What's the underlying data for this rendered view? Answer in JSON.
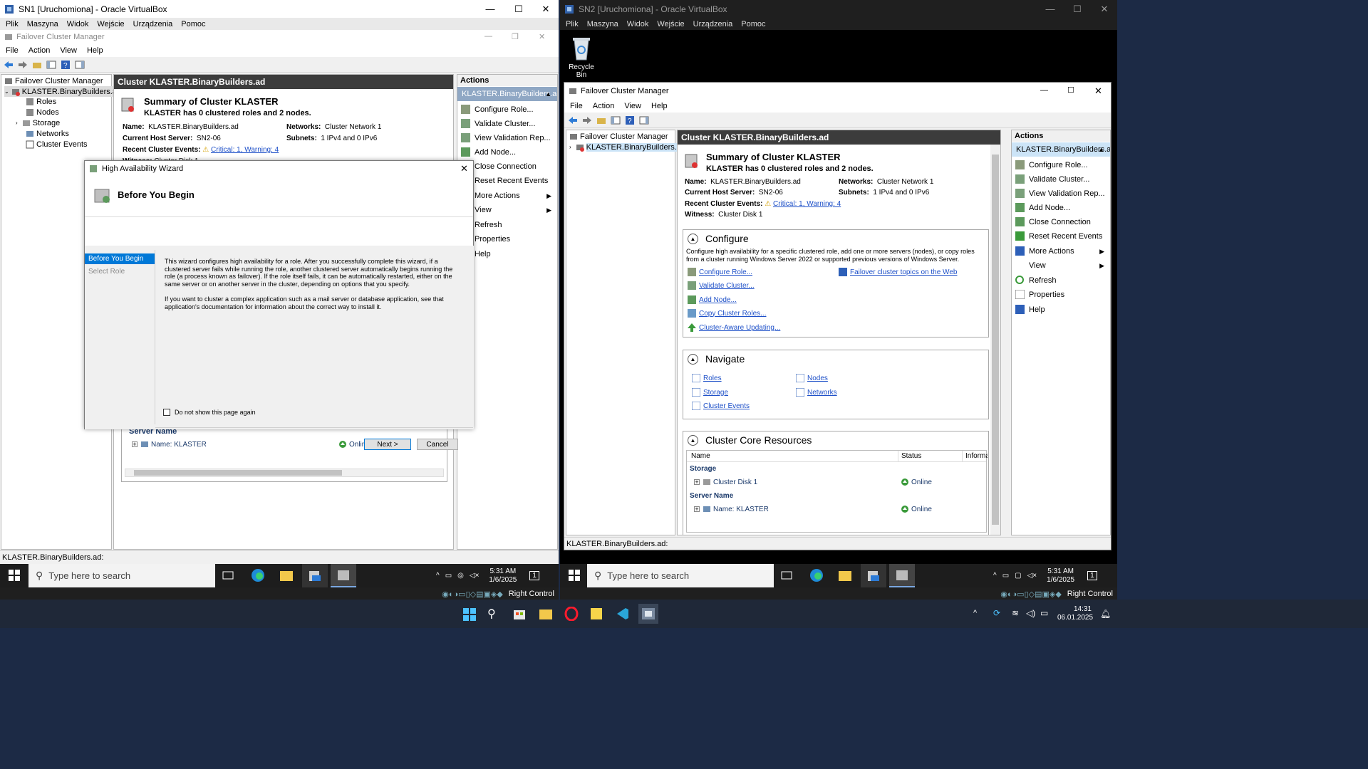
{
  "vm1": {
    "window_title": "SN1 [Uruchomiona] - Oracle VirtualBox",
    "menu": [
      "Plik",
      "Maszyna",
      "Widok",
      "Wejście",
      "Urządzenia",
      "Pomoc"
    ],
    "fcm": {
      "title": "Failover Cluster Manager",
      "menu": [
        "File",
        "Action",
        "View",
        "Help"
      ],
      "tree": {
        "root": "Failover Cluster Manager",
        "cluster": "KLASTER.BinaryBuilders.ad",
        "children": [
          "Roles",
          "Nodes",
          "Storage",
          "Networks",
          "Cluster Events"
        ]
      },
      "center": {
        "header": "Cluster KLASTER.BinaryBuilders.ad",
        "summary_title": "Summary of Cluster KLASTER",
        "summary_sub": "KLASTER has 0 clustered roles and 2 nodes.",
        "name_label": "Name:",
        "name_value": "KLASTER.BinaryBuilders.ad",
        "host_label": "Current Host Server:",
        "host_value": "SN2-06",
        "events_label": "Recent Cluster Events:",
        "events_value": "Critical: 1, Warning: 4",
        "witness_label": "Witness:",
        "witness_value": "Cluster Disk 1",
        "networks_label": "Networks:",
        "networks_value": "Cluster Network 1",
        "subnets_label": "Subnets:",
        "subnets_value": "1 IPv4 and 0 IPv6",
        "server_name_header": "Server Name",
        "server_row_name": "Name: KLASTER",
        "server_row_status": "Online"
      },
      "actions": {
        "header": "Actions",
        "selected": "KLASTER.BinaryBuilders.ad",
        "items": [
          "Configure Role...",
          "Validate Cluster...",
          "View Validation Rep...",
          "Add Node...",
          "Close Connection",
          "Reset Recent Events",
          "More Actions",
          "View",
          "Refresh",
          "Properties",
          "Help"
        ]
      },
      "status": "KLASTER.BinaryBuilders.ad:"
    },
    "wizard": {
      "title": "High Availability Wizard",
      "heading": "Before You Begin",
      "steps": [
        "Before You Begin",
        "Select Role"
      ],
      "para1": "This wizard configures high availability for a role. After you successfully complete this wizard, if a clustered server fails while running the role, another clustered server automatically begins running the role (a process known as failover). If the role itself fails, it can be automatically restarted, either on the same server or on another server in the cluster, depending on options that you specify.",
      "para2": "If you want to cluster a complex application such as a mail server or database application, see that application's documentation for information about the correct way to install it.",
      "checkbox": "Do not show this page again",
      "next": "Next >",
      "cancel": "Cancel"
    },
    "taskbar": {
      "search_placeholder": "Type here to search",
      "time": "5:31 AM",
      "date": "1/6/2025",
      "notif": "1"
    },
    "vb_status": "Right Control"
  },
  "vm2": {
    "window_title": "SN2 [Uruchomiona] - Oracle VirtualBox",
    "menu": [
      "Plik",
      "Maszyna",
      "Widok",
      "Wejście",
      "Urządzenia",
      "Pomoc"
    ],
    "desktop_icon": "Recycle Bin",
    "fcm": {
      "title": "Failover Cluster Manager",
      "menu": [
        "File",
        "Action",
        "View",
        "Help"
      ],
      "tree": {
        "root": "Failover Cluster Manager",
        "cluster": "KLASTER.BinaryBuilders.ad"
      },
      "center": {
        "header": "Cluster KLASTER.BinaryBuilders.ad",
        "summary_title": "Summary of Cluster KLASTER",
        "summary_sub": "KLASTER has 0 clustered roles and 2 nodes.",
        "name_label": "Name:",
        "name_value": "KLASTER.BinaryBuilders.ad",
        "host_label": "Current Host Server:",
        "host_value": "SN2-06",
        "events_label": "Recent Cluster Events:",
        "events_value": "Critical: 1, Warning: 4",
        "witness_label": "Witness:",
        "witness_value": "Cluster Disk 1",
        "networks_label": "Networks:",
        "networks_value": "Cluster Network 1",
        "subnets_label": "Subnets:",
        "subnets_value": "1 IPv4 and 0 IPv6",
        "configure": {
          "title": "Configure",
          "desc": "Configure high availability for a specific clustered role, add one or more servers (nodes), or copy roles from a cluster running Windows Server 2022 or supported previous versions of Windows Server.",
          "links": [
            "Configure Role...",
            "Validate Cluster...",
            "Add Node...",
            "Copy Cluster Roles...",
            "Cluster-Aware Updating..."
          ],
          "web_link": "Failover cluster topics on the Web"
        },
        "navigate": {
          "title": "Navigate",
          "links": [
            "Roles",
            "Nodes",
            "Storage",
            "Networks",
            "Cluster Events"
          ]
        },
        "core": {
          "title": "Cluster Core Resources",
          "columns": [
            "Name",
            "Status",
            "Informat"
          ],
          "storage_group": "Storage",
          "disk_name": "Cluster Disk 1",
          "disk_status": "Online",
          "server_group": "Server Name",
          "server_name": "Name: KLASTER",
          "server_status": "Online"
        }
      },
      "actions": {
        "header": "Actions",
        "selected": "KLASTER.BinaryBuilders.ad",
        "items": [
          "Configure Role...",
          "Validate Cluster...",
          "View Validation Rep...",
          "Add Node...",
          "Close Connection",
          "Reset Recent Events",
          "More Actions",
          "View",
          "Refresh",
          "Properties",
          "Help"
        ]
      },
      "status": "KLASTER.BinaryBuilders.ad:"
    },
    "taskbar": {
      "search_placeholder": "Type here to search",
      "time": "5:31 AM",
      "date": "1/6/2025",
      "notif": "1"
    },
    "vb_status": "Right Control"
  },
  "host_taskbar": {
    "time": "14:31",
    "date": "06.01.2025"
  },
  "colors": {
    "header_dark": "#3c3c3c",
    "action_selected": "#8fa7c4",
    "link": "#1e50c8",
    "wizard_step_selected": "#0078d7"
  }
}
